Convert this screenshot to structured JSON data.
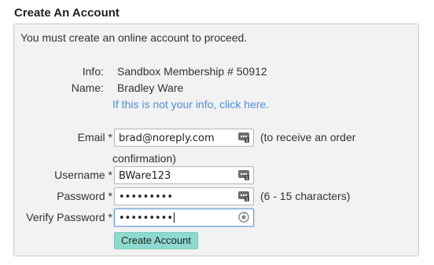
{
  "page": {
    "heading": "Create An Account"
  },
  "panel": {
    "intro": "You must create an online account to proceed.",
    "info_label": "Info:",
    "info_value": "Sandbox Membership # 50912",
    "name_label": "Name:",
    "name_value": "Bradley Ware",
    "not_you_link": "If this is not your info, click here."
  },
  "form": {
    "email_label": "Email *",
    "email_value": "brad@noreply.com",
    "email_hint_line1": "(to receive an order",
    "email_hint_line2": "confirmation)",
    "username_label": "Username *",
    "username_value": "BWare123",
    "password_label": "Password *",
    "password_value": "•••••••••",
    "password_hint": "(6 - 15 characters)",
    "verify_label": "Verify Password *",
    "verify_value": "•••••••••",
    "submit_label": "Create Account"
  },
  "icons": {
    "field_autofill": "password-manager-icon",
    "verify_field": "password-generator-icon"
  }
}
